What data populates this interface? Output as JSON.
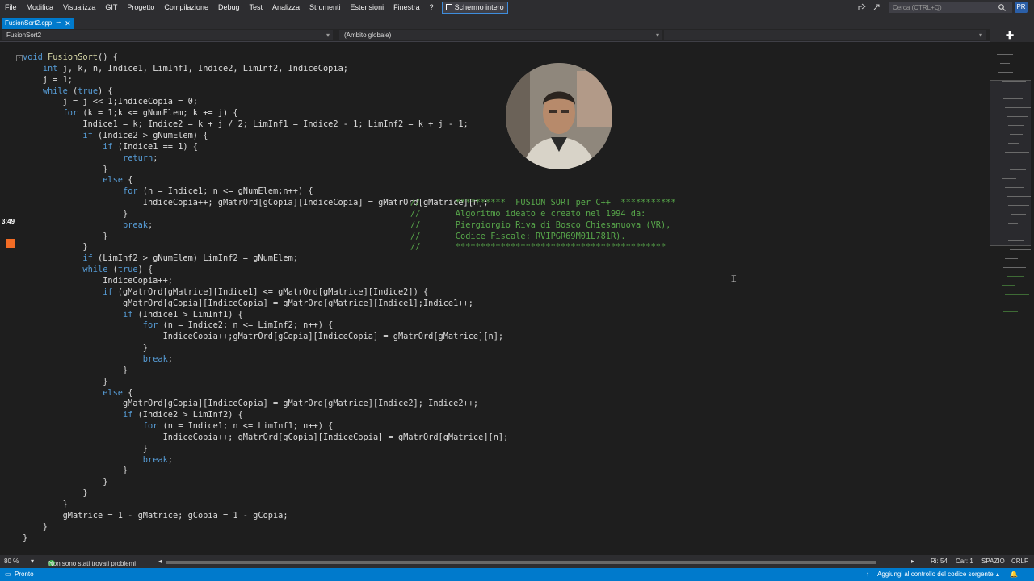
{
  "menu": {
    "items": [
      "File",
      "Modifica",
      "Visualizza",
      "GIT",
      "Progetto",
      "Compilazione",
      "Debug",
      "Test",
      "Analizza",
      "Strumenti",
      "Estensioni",
      "Finestra",
      "?"
    ],
    "fullscreen_label": "Schermo intero",
    "search_placeholder": "Cerca (CTRL+Q)",
    "user_initials": "PR"
  },
  "tab": {
    "label": "FusionSort2.cpp"
  },
  "nav": {
    "project": "FusionSort2",
    "scope": "(Ambito globale)"
  },
  "recording": {
    "timer": "3:49"
  },
  "code": {
    "lines": [
      "void FusionSort() {",
      "    int j, k, n, Indice1, LimInf1, Indice2, LimInf2, IndiceCopia;",
      "    j = 1;",
      "    while (true) {",
      "        j = j << 1;IndiceCopia = 0;",
      "        for (k = 1;k <= gNumElem; k += j) {",
      "            Indice1 = k; Indice2 = k + j / 2; LimInf1 = Indice2 - 1; LimInf2 = k + j - 1;",
      "            if (Indice2 > gNumElem) {",
      "                if (Indice1 == 1) {",
      "                    return;",
      "                }",
      "                else {",
      "                    for (n = Indice1; n <= gNumElem;n++) {",
      "                        IndiceCopia++; gMatrOrd[gCopia][IndiceCopia] = gMatrOrd[gMatrice][n];",
      "                    }",
      "                    break;",
      "                }",
      "            }",
      "            if (LimInf2 > gNumElem) LimInf2 = gNumElem;",
      "            while (true) {",
      "                IndiceCopia++;",
      "                if (gMatrOrd[gMatrice][Indice1] <= gMatrOrd[gMatrice][Indice2]) {",
      "                    gMatrOrd[gCopia][IndiceCopia] = gMatrOrd[gMatrice][Indice1];Indice1++;",
      "                    if (Indice1 > LimInf1) {",
      "                        for (n = Indice2; n <= LimInf2; n++) {",
      "                            IndiceCopia++;gMatrOrd[gCopia][IndiceCopia] = gMatrOrd[gMatrice][n];",
      "                        }",
      "                        break;",
      "                    }",
      "                }",
      "                else {",
      "                    gMatrOrd[gCopia][IndiceCopia] = gMatrOrd[gMatrice][Indice2]; Indice2++;",
      "                    if (Indice2 > LimInf2) {",
      "                        for (n = Indice1; n <= LimInf1; n++) {",
      "                            IndiceCopia++; gMatrOrd[gCopia][IndiceCopia] = gMatrOrd[gMatrice][n];",
      "                        }",
      "                        break;",
      "                    }",
      "                }",
      "            }",
      "        }",
      "        gMatrice = 1 - gMatrice; gCopia = 1 - gCopia;",
      "    }",
      "}"
    ],
    "comments": [
      "//       **********  FUSION SORT per C++  ***********",
      "//       Algoritmo ideato e creato nel 1994 da:",
      "//       Piergiorgio Riva di Bosco Chiesanuova (VR),",
      "//       Codice Fiscale: RVIPGR69M01L781R).",
      "//       ******************************************"
    ]
  },
  "editor_status": {
    "zoom": "80 %",
    "issues": "Non sono stati trovati problemi",
    "line": "Ri: 54",
    "col": "Car: 1",
    "spacing": "SPAZIO",
    "eol": "CRLF"
  },
  "status": {
    "ready": "Pronto",
    "source_control": "Aggiungi al controllo del codice sorgente"
  },
  "colors": {
    "accent": "#007acc",
    "keyword": "#569cd6",
    "comment": "#57a64a",
    "record": "#f26c25"
  }
}
